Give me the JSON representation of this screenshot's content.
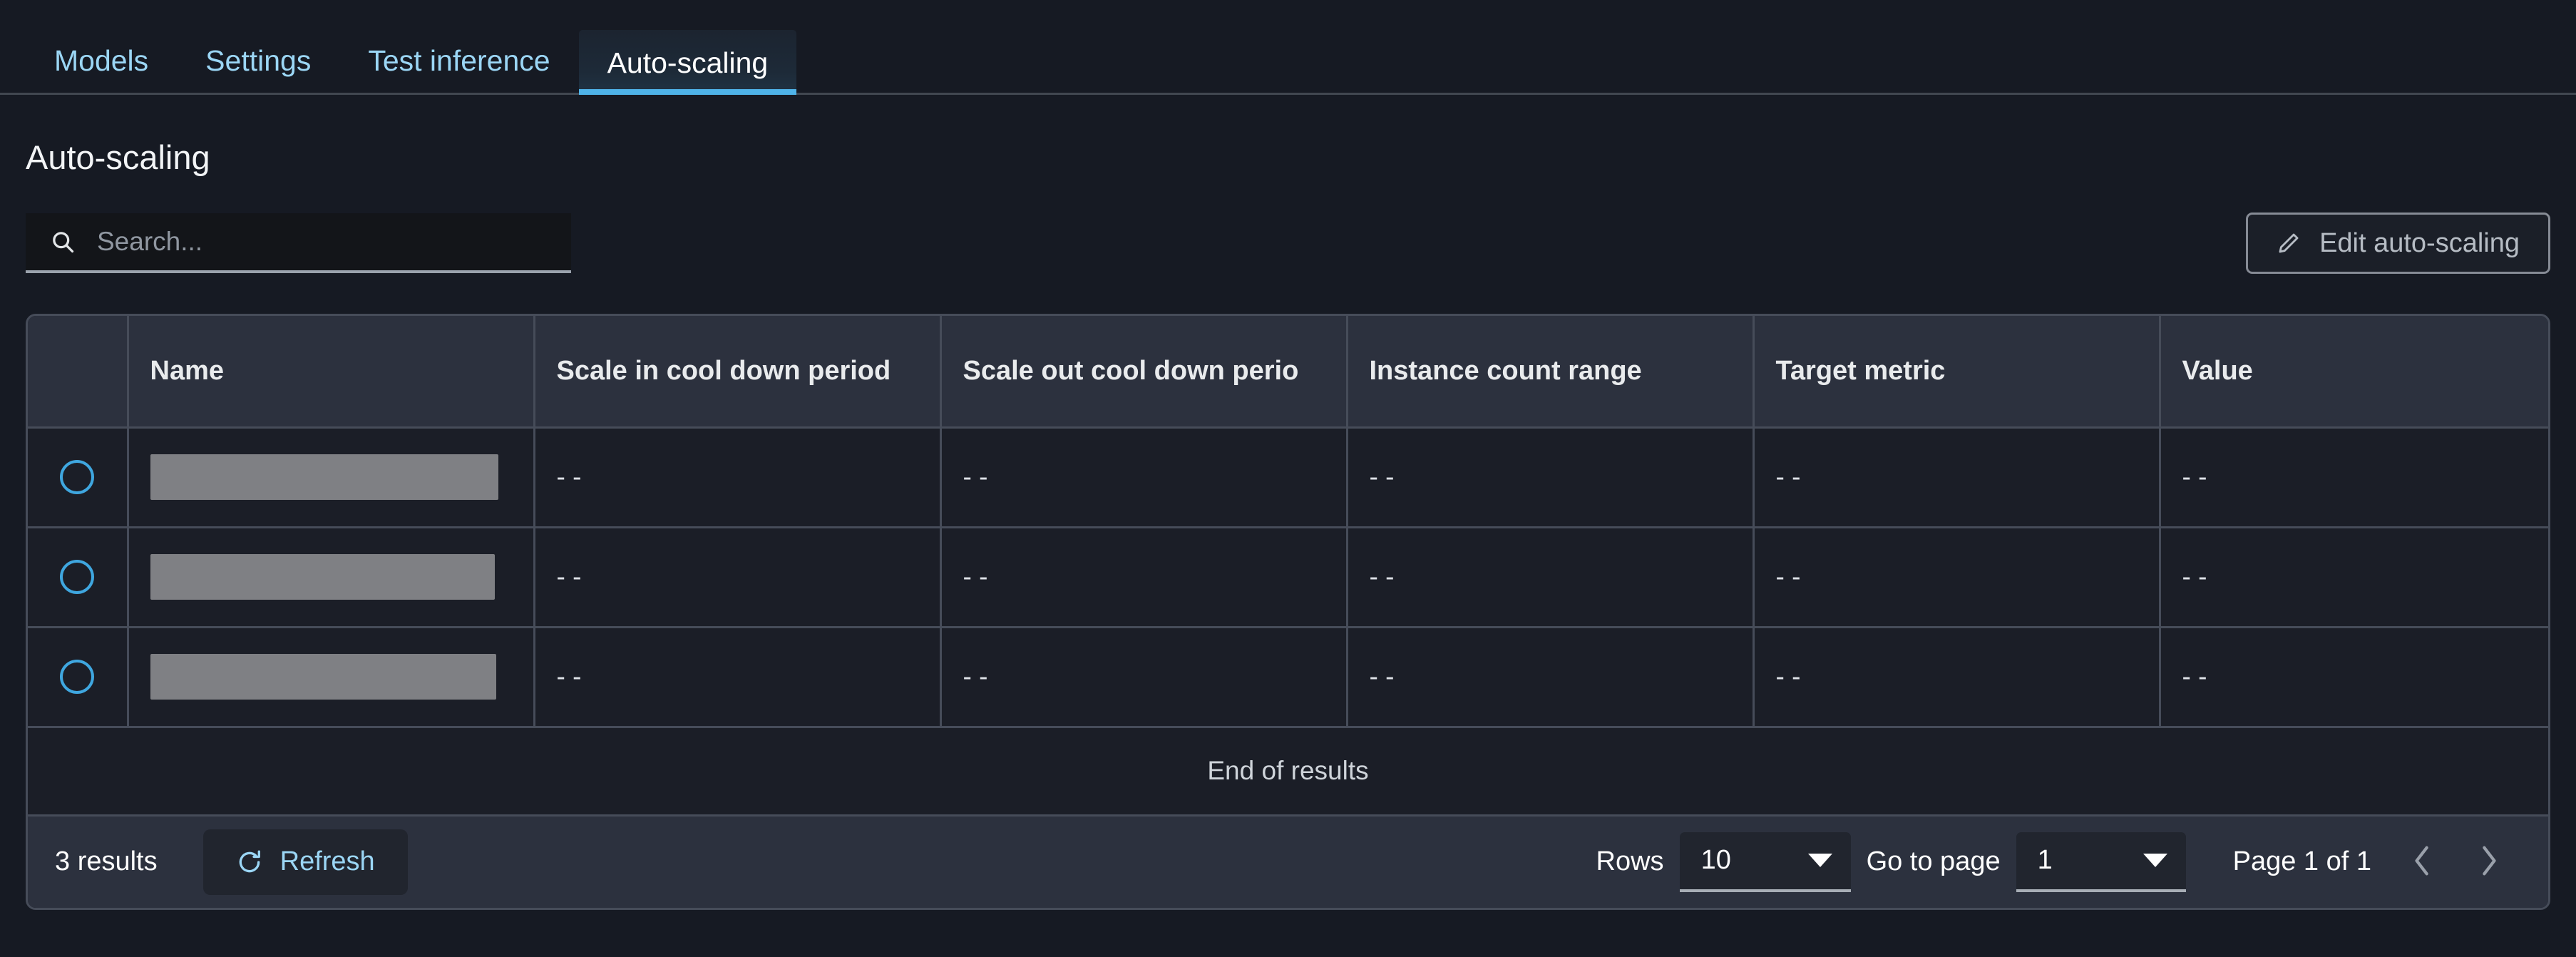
{
  "tabs": [
    {
      "label": "Models",
      "active": false
    },
    {
      "label": "Settings",
      "active": false
    },
    {
      "label": "Test inference",
      "active": false
    },
    {
      "label": "Auto-scaling",
      "active": true
    }
  ],
  "page": {
    "title": "Auto-scaling"
  },
  "search": {
    "placeholder": "Search...",
    "value": "",
    "icon": "search-icon"
  },
  "edit_button": {
    "label": "Edit auto-scaling",
    "icon": "pencil-icon"
  },
  "table": {
    "columns": [
      {
        "key": "select",
        "label": ""
      },
      {
        "key": "name",
        "label": "Name"
      },
      {
        "key": "scale_in",
        "label": "Scale in cool down period"
      },
      {
        "key": "scale_out",
        "label": "Scale out cool down perio"
      },
      {
        "key": "instance_range",
        "label": "Instance count range"
      },
      {
        "key": "target_metric",
        "label": "Target metric"
      },
      {
        "key": "value",
        "label": "Value"
      }
    ],
    "rows": [
      {
        "name": "",
        "name_redacted": true,
        "scale_in": "- -",
        "scale_out": "- -",
        "instance_range": "- -",
        "target_metric": "- -",
        "value": "- -"
      },
      {
        "name": "",
        "name_redacted": true,
        "scale_in": "- -",
        "scale_out": "- -",
        "instance_range": "- -",
        "target_metric": "- -",
        "value": "- -"
      },
      {
        "name": "",
        "name_redacted": true,
        "scale_in": "- -",
        "scale_out": "- -",
        "instance_range": "- -",
        "target_metric": "- -",
        "value": "- -"
      }
    ],
    "end_of_results": "End of results"
  },
  "footer": {
    "results_count": "3 results",
    "refresh_label": "Refresh",
    "refresh_icon": "refresh-icon",
    "rows_label": "Rows",
    "rows_value": "10",
    "goto_label": "Go to page",
    "goto_value": "1",
    "page_indicator": "Page 1 of 1",
    "prev_icon": "chevron-left-icon",
    "next_icon": "chevron-right-icon"
  },
  "colors": {
    "accent_blue": "#4fb3e8",
    "link_blue": "#9bd6f5",
    "radio_blue": "#3fa7e0",
    "header_bg": "#2c313e",
    "row_bg": "#1b1e27",
    "page_bg": "#161a23",
    "border": "#464c59",
    "redaction_gray": "#7f8084"
  }
}
